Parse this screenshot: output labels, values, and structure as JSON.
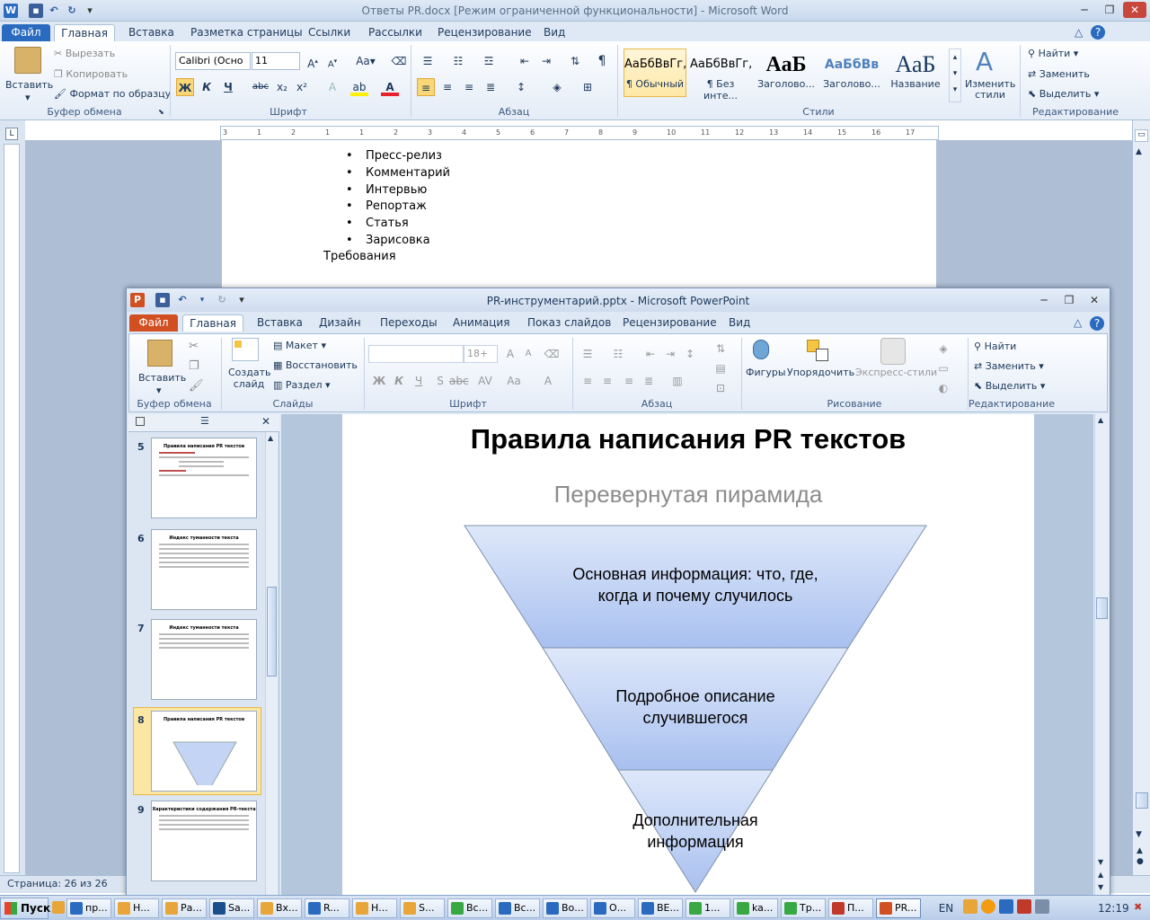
{
  "word": {
    "title": "Ответы PR.docx [Режим ограниченной функциональности]  -  Microsoft Word",
    "tabs": [
      "Файл",
      "Главная",
      "Вставка",
      "Разметка страницы",
      "Ссылки",
      "Рассылки",
      "Рецензирование",
      "Вид"
    ],
    "clipboard": {
      "paste": "Вставить",
      "cut": "Вырезать",
      "copy": "Копировать",
      "format_painter": "Формат по образцу",
      "group": "Буфер обмена"
    },
    "font": {
      "name": "Calibri (Осно",
      "size": "11",
      "group": "Шрифт",
      "bold": "Ж",
      "italic": "К",
      "underline": "Ч",
      "strike": "abc",
      "sub": "x₂",
      "sup": "x²"
    },
    "paragraph": {
      "group": "Абзац"
    },
    "styles": {
      "group": "Стили",
      "items": [
        {
          "preview": "АаБбВвГг,",
          "name": "¶ Обычный"
        },
        {
          "preview": "АаБбВвГг,",
          "name": "¶ Без инте..."
        },
        {
          "preview": "АаБ",
          "name": "Заголово..."
        },
        {
          "preview": "АаБбВв",
          "name": "Заголово..."
        },
        {
          "preview": "АаБ",
          "name": "Название"
        }
      ],
      "change": "Изменить стили"
    },
    "editing": {
      "group": "Редактирование",
      "find": "Найти",
      "replace": "Заменить",
      "select": "Выделить"
    },
    "ruler": [
      "3",
      "1",
      "2",
      "1",
      "1",
      "2",
      "3",
      "4",
      "5",
      "6",
      "7",
      "8",
      "9",
      "10",
      "11",
      "12",
      "13",
      "14",
      "15",
      "16",
      "17"
    ],
    "doc": {
      "bullets": [
        "Пресс-релиз",
        "Комментарий",
        "Интервью",
        "Репортаж",
        "Статья",
        "Зарисовка"
      ],
      "req": "Требования"
    },
    "status": "Страница: 26 из 26"
  },
  "pp": {
    "title": "PR-инструментарий.pptx  -  Microsoft PowerPoint",
    "tabs": [
      "Файл",
      "Главная",
      "Вставка",
      "Дизайн",
      "Переходы",
      "Анимация",
      "Показ слайдов",
      "Рецензирование",
      "Вид"
    ],
    "clipboard": {
      "paste": "Вставить",
      "group": "Буфер обмена"
    },
    "slides": {
      "new": "Создать слайд",
      "layout": "Макет",
      "reset": "Восстановить",
      "section": "Раздел",
      "group": "Слайды"
    },
    "font": {
      "size": "18+",
      "group": "Шрифт"
    },
    "paragraph": {
      "group": "Абзац"
    },
    "drawing": {
      "shapes": "Фигуры",
      "arrange": "Упорядочить",
      "quick_styles": "Экспресс-стили",
      "group": "Рисование"
    },
    "editing": {
      "find": "Найти",
      "replace": "Заменить",
      "select": "Выделить",
      "group": "Редактирование"
    },
    "thumbs": [
      {
        "num": "5",
        "title": "Правила написания PR текстов"
      },
      {
        "num": "6",
        "title": "Индекс туманности текста"
      },
      {
        "num": "7",
        "title": "Индекс туманности текста"
      },
      {
        "num": "8",
        "title": "Правила написания PR текстов"
      },
      {
        "num": "9",
        "title": "Характеристики содержания PR-текста"
      }
    ],
    "slide": {
      "title": "Правила написания PR текстов",
      "subtitle": "Перевернутая пирамида",
      "levels": [
        "Основная информация: что, где,\nкогда и почему случилось",
        "Подробное описание\nслучившегося",
        "Дополнительная\nинформация"
      ]
    }
  },
  "taskbar": {
    "start": "Пуск",
    "items": [
      "пр...",
      "Н...",
      "Ра...",
      "Sa...",
      "Вх...",
      "R...",
      "Н...",
      "S...",
      "Вс...",
      "Вс...",
      "Во...",
      "О...",
      "ВЕ...",
      "1...",
      "ka...",
      "Тр...",
      "П...",
      "PR..."
    ],
    "lang": "EN",
    "clock": "12:19"
  },
  "colors": {
    "word_file": "#2a6bc0",
    "pp_file": "#d14f21",
    "pyramid_top": "#a8c0ef",
    "pyramid_bottom": "#dfe8fa"
  }
}
